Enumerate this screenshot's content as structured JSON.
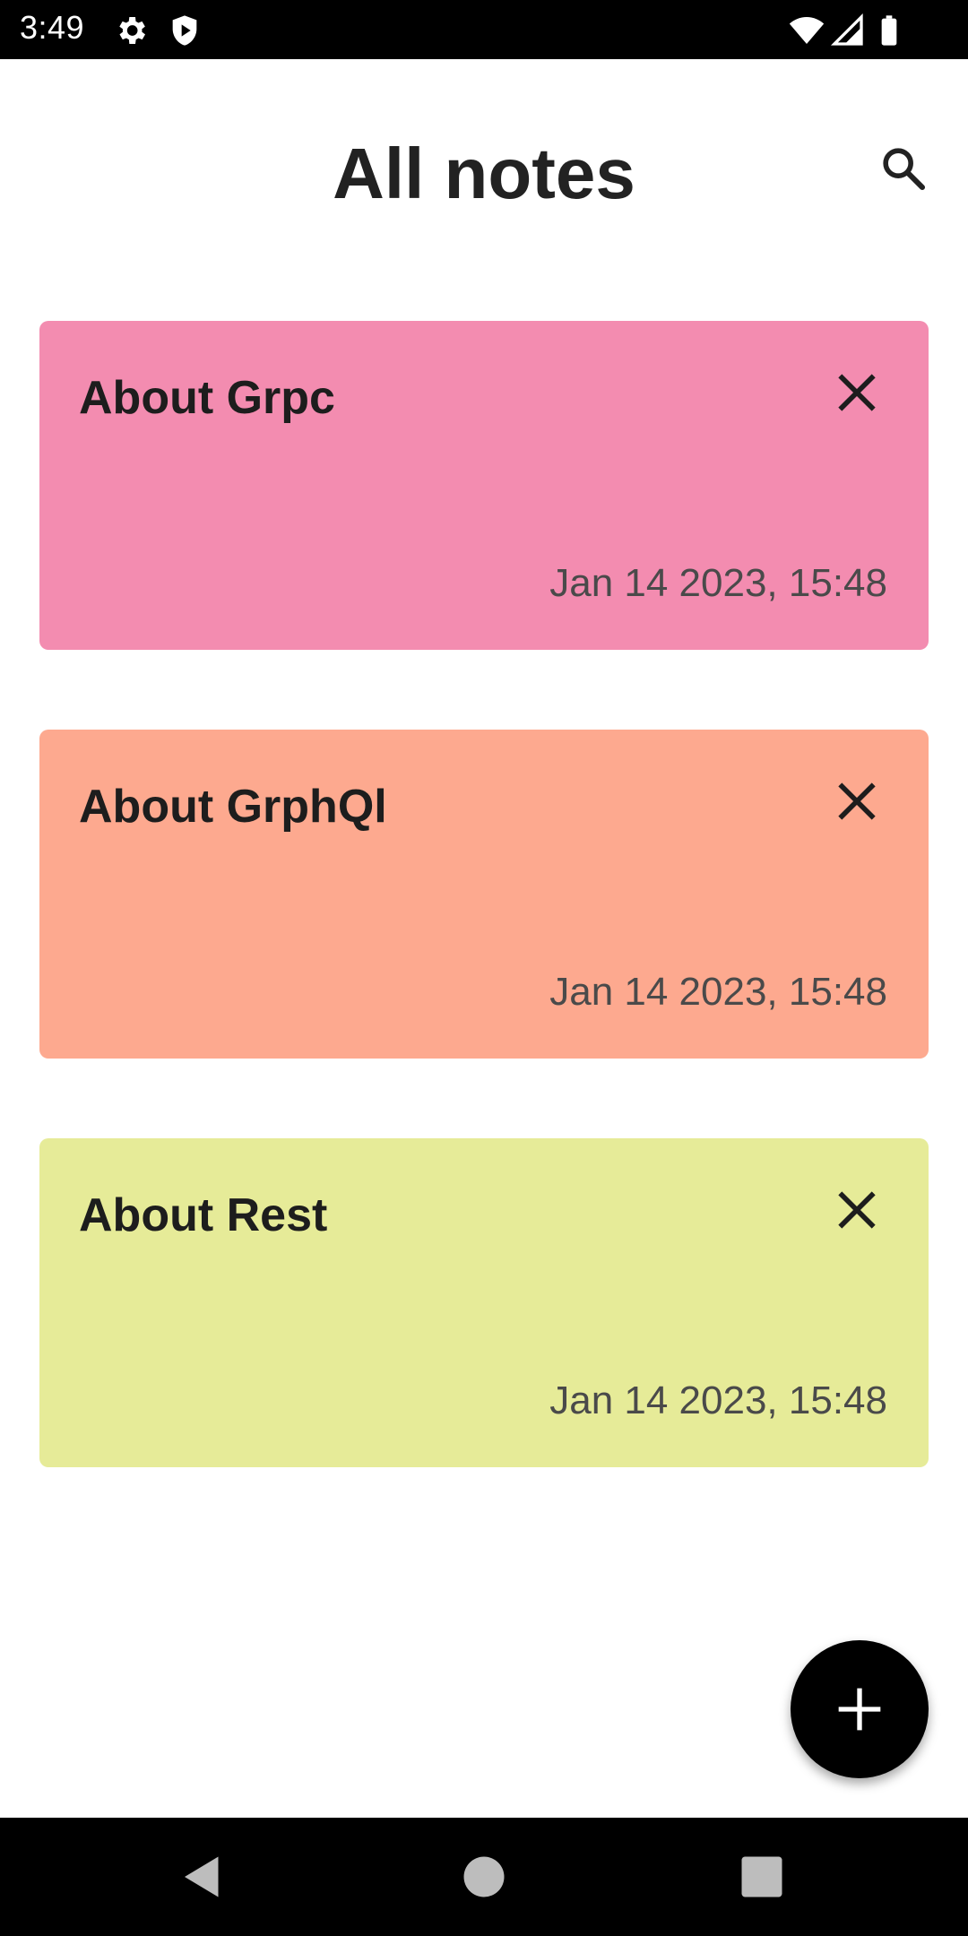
{
  "status_bar": {
    "time": "3:49",
    "icons": [
      "gear-icon",
      "shield-play-icon",
      "wifi-icon",
      "cellular-icon",
      "battery-icon"
    ]
  },
  "header": {
    "title": "All notes",
    "search_icon": "search-icon"
  },
  "notes": [
    {
      "title": "About Grpc",
      "date": "Jan 14 2023, 15:48",
      "color": "#F38CB0"
    },
    {
      "title": "About GrphQl",
      "date": "Jan 14 2023, 15:48",
      "color": "#FDA98F"
    },
    {
      "title": "About Rest",
      "date": "Jan 14 2023, 15:48",
      "color": "#E6EB98"
    }
  ],
  "fab": {
    "icon": "plus-icon"
  },
  "nav_bar": {
    "icons": [
      "back-icon",
      "home-icon",
      "recents-icon"
    ]
  },
  "colors": {
    "background": "#FFFFFF",
    "bars": "#000000",
    "title_text": "#222222"
  }
}
